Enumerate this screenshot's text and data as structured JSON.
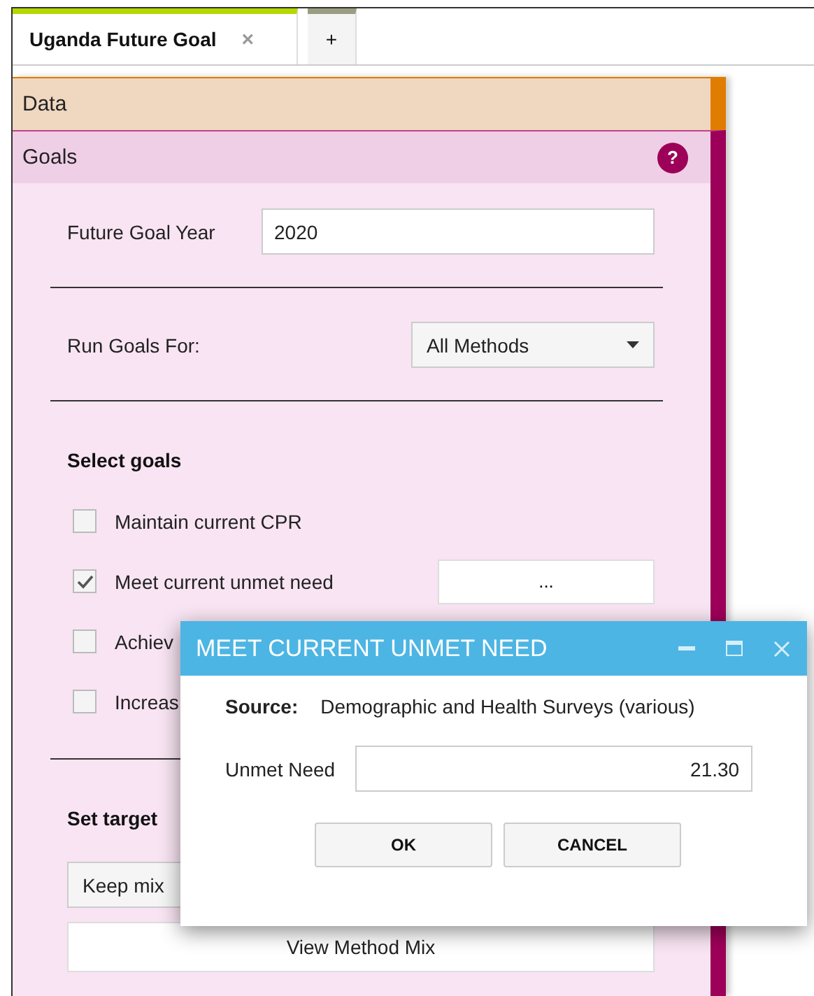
{
  "tabs": [
    {
      "label": "Uganda Future Goal",
      "close": "×",
      "selected": true
    },
    {
      "label": "+",
      "selected": false
    }
  ],
  "sections": [
    {
      "title": "Data",
      "kind": "data"
    },
    {
      "title": "Goals",
      "kind": "goals",
      "help": "?"
    }
  ],
  "goals_form": {
    "year_label": "Future Goal Year",
    "year_value": "2020",
    "run_label": "Run Goals For:",
    "run_value": "All Methods",
    "select_heading": "Select goals",
    "goals": [
      {
        "label": "Maintain current CPR",
        "checked": false
      },
      {
        "label": "Meet current unmet need",
        "checked": true,
        "button": "..."
      },
      {
        "label": "Achiev",
        "checked": false
      },
      {
        "label": "Increas",
        "checked": false
      }
    ],
    "target_heading": "Set target",
    "mix_value": "Keep mix",
    "view_button": "View Method Mix"
  },
  "dialog": {
    "title": "MEET CURRENT UNMET NEED",
    "source_label": "Source:",
    "source_value": "Demographic and Health Surveys (various)",
    "field_label": "Unmet Need",
    "field_value": "21.30",
    "buttons": [
      "OK",
      "CANCEL"
    ]
  }
}
